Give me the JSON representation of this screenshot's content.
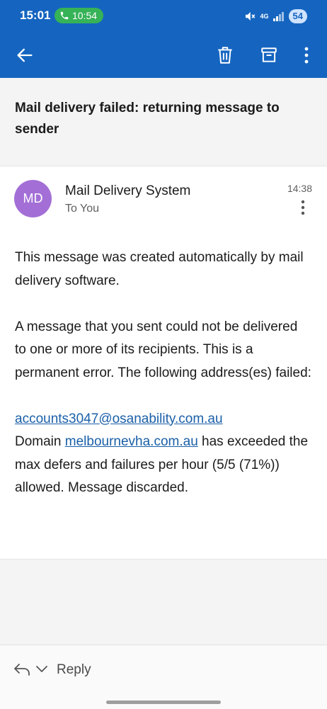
{
  "status_bar": {
    "clock": "15:01",
    "call_time": "10:54",
    "network_label": "4G",
    "battery": "54"
  },
  "toolbar": {
    "back_icon": "arrow-left-icon",
    "delete_icon": "trash-icon",
    "archive_icon": "archive-icon",
    "more_icon": "more-vert-icon"
  },
  "message": {
    "subject": "Mail delivery failed: returning message to sender",
    "avatar_initials": "MD",
    "avatar_color": "#a36fd6",
    "sender": "Mail Delivery System",
    "recipient": "To You",
    "time": "14:38",
    "body": {
      "para1": "This message was created automatically by mail delivery software.",
      "para2": "A message that you sent could not be delivered to one or more of its recipients. This is a permanent error. The following address(es) failed:",
      "failed_address": "accounts3047@osanability.com.au",
      "domain_prefix": "Domain",
      "domain": "melbournevha.com.au",
      "domain_suffix": "has exceeded the max defers and failures per hour (5/5 (71%)) allowed. Message discarded."
    }
  },
  "footer": {
    "reply_label": "Reply"
  },
  "colors": {
    "app_bar": "#1565c0",
    "link": "#1a5fa8",
    "call_pill": "#36b257"
  }
}
